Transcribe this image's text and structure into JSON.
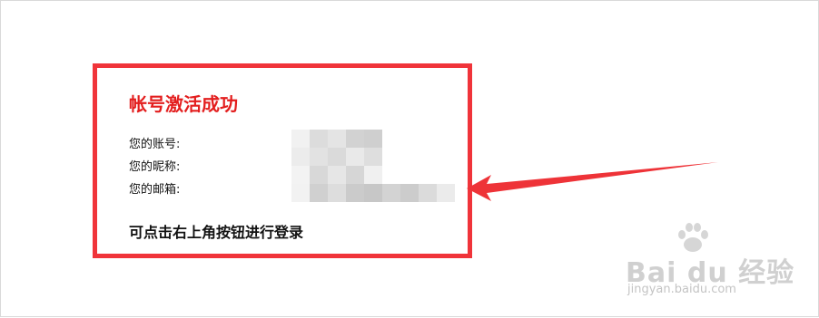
{
  "card": {
    "title": "帐号激活成功",
    "account_label": "您的账号:",
    "nickname_label": "您的昵称:",
    "email_label": "您的邮箱:",
    "login_hint": "可点击右上角按钮进行登录"
  },
  "watermark": {
    "brand": "Bai du 经验",
    "url": "jingyan.baidu.com"
  },
  "colors": {
    "highlight_border": "#f0343a",
    "title": "#e31e1e",
    "arrow": "#ee3338"
  }
}
